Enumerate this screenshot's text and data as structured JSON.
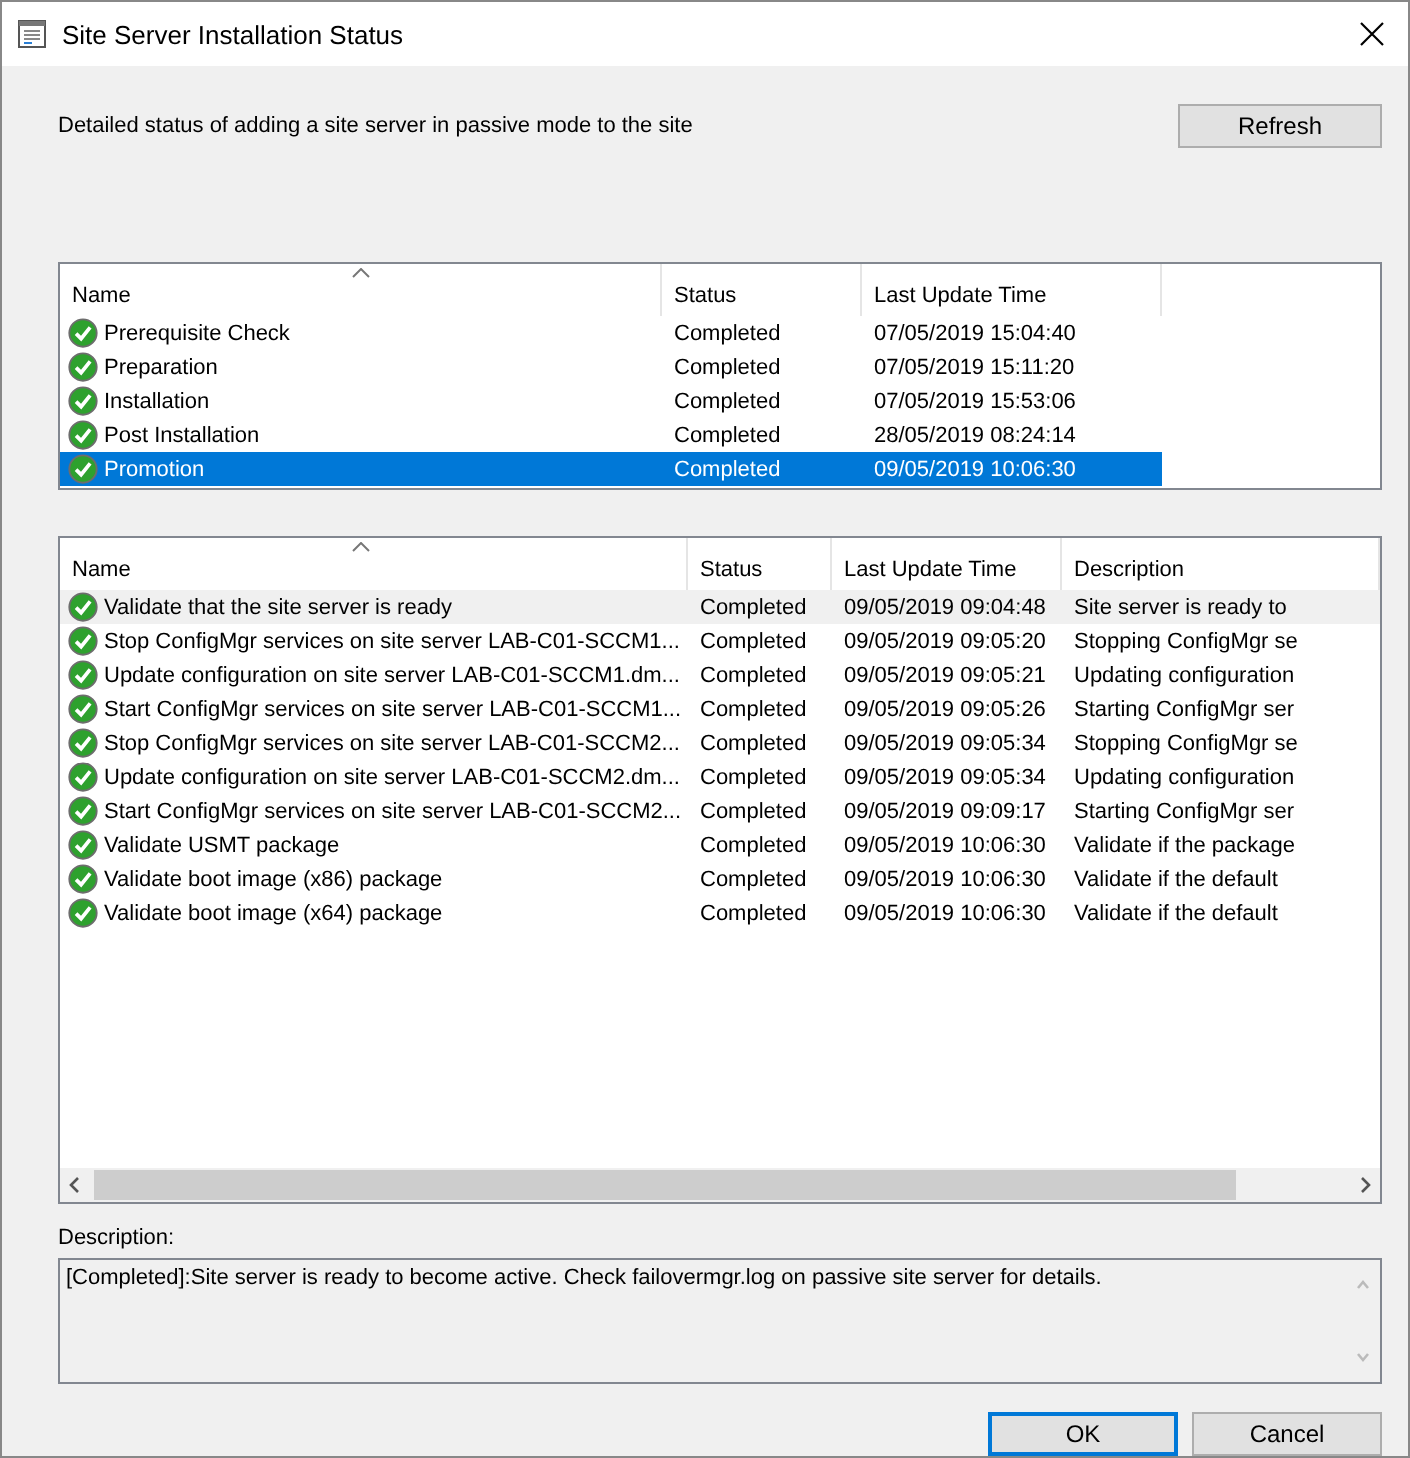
{
  "window": {
    "title": "Site Server Installation Status"
  },
  "intro": "Detailed status of adding a site server in passive mode to the site",
  "refresh_button": "Refresh",
  "phases": {
    "columns": [
      "Name",
      "Status",
      "Last Update Time"
    ],
    "rows": [
      {
        "name": "Prerequisite Check",
        "status": "Completed",
        "time": "07/05/2019 15:04:40",
        "selected": false
      },
      {
        "name": "Preparation",
        "status": "Completed",
        "time": "07/05/2019 15:11:20",
        "selected": false
      },
      {
        "name": "Installation",
        "status": "Completed",
        "time": "07/05/2019 15:53:06",
        "selected": false
      },
      {
        "name": "Post Installation",
        "status": "Completed",
        "time": "28/05/2019 08:24:14",
        "selected": false
      },
      {
        "name": "Promotion",
        "status": "Completed",
        "time": "09/05/2019 10:06:30",
        "selected": true
      }
    ]
  },
  "steps": {
    "columns": [
      "Name",
      "Status",
      "Last Update Time",
      "Description"
    ],
    "rows": [
      {
        "name": "Validate that the site server is ready",
        "status": "Completed",
        "time": "09/05/2019 09:04:48",
        "description": "Site server is ready to",
        "selected": true
      },
      {
        "name": "Stop ConfigMgr services on site server LAB-C01-SCCM1...",
        "status": "Completed",
        "time": "09/05/2019 09:05:20",
        "description": "Stopping ConfigMgr se",
        "selected": false
      },
      {
        "name": "Update configuration on site server LAB-C01-SCCM1.dm...",
        "status": "Completed",
        "time": "09/05/2019 09:05:21",
        "description": "Updating configuration",
        "selected": false
      },
      {
        "name": "Start ConfigMgr services on site server LAB-C01-SCCM1...",
        "status": "Completed",
        "time": "09/05/2019 09:05:26",
        "description": "Starting ConfigMgr ser",
        "selected": false
      },
      {
        "name": "Stop ConfigMgr services on site server LAB-C01-SCCM2...",
        "status": "Completed",
        "time": "09/05/2019 09:05:34",
        "description": "Stopping ConfigMgr se",
        "selected": false
      },
      {
        "name": "Update configuration on site server LAB-C01-SCCM2.dm...",
        "status": "Completed",
        "time": "09/05/2019 09:05:34",
        "description": "Updating configuration",
        "selected": false
      },
      {
        "name": "Start ConfigMgr services on site server LAB-C01-SCCM2...",
        "status": "Completed",
        "time": "09/05/2019 09:09:17",
        "description": "Starting ConfigMgr ser",
        "selected": false
      },
      {
        "name": "Validate USMT package",
        "status": "Completed",
        "time": "09/05/2019 10:06:30",
        "description": "Validate if the package",
        "selected": false
      },
      {
        "name": "Validate boot image (x86) package",
        "status": "Completed",
        "time": "09/05/2019 10:06:30",
        "description": "Validate if the default",
        "selected": false
      },
      {
        "name": "Validate boot image (x64) package",
        "status": "Completed",
        "time": "09/05/2019 10:06:30",
        "description": "Validate if the default",
        "selected": false
      }
    ]
  },
  "description": {
    "label": "Description:",
    "text": "[Completed]:Site server is ready to become active. Check failovermgr.log on passive site server for details."
  },
  "buttons": [
    {
      "label": "OK",
      "default": true
    },
    {
      "label": "Cancel",
      "default": false
    }
  ]
}
